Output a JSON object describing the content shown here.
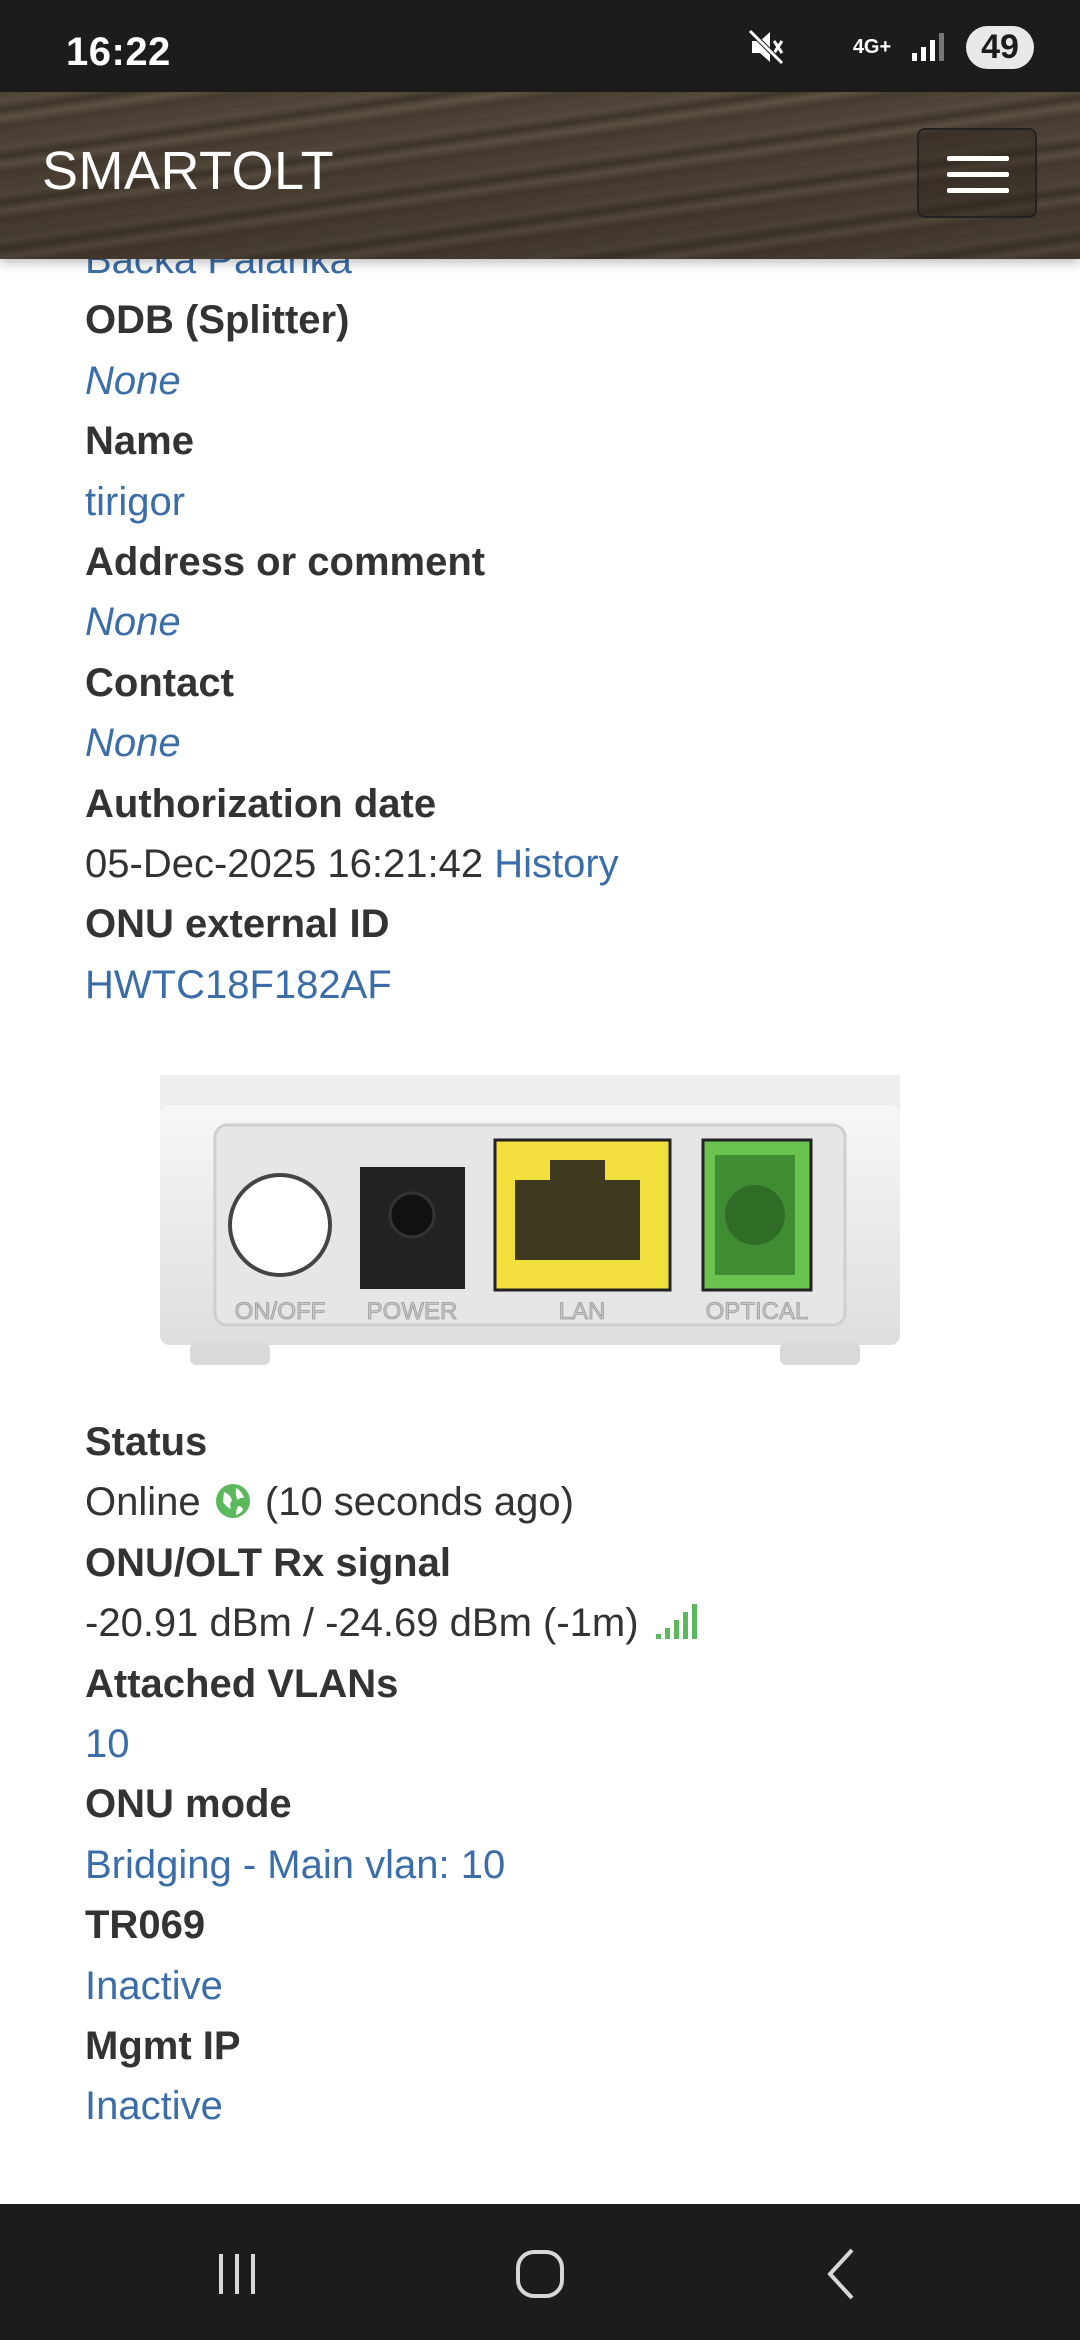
{
  "status_bar": {
    "time": "16:22",
    "network": "4G+",
    "battery": "49"
  },
  "navbar": {
    "brand": "SMARTOLT"
  },
  "details_top": {
    "partial_value": "Backa Palanka",
    "odb_label": "ODB (Splitter)",
    "odb_value": "None",
    "name_label": "Name",
    "name_value": "tirigor",
    "address_label": "Address or comment",
    "address_value": "None",
    "contact_label": "Contact",
    "contact_value": "None",
    "auth_label": "Authorization date",
    "auth_value": "05-Dec-2025 16:21:42",
    "history_link": "History",
    "ext_id_label": "ONU external ID",
    "ext_id_value": "HWTC18F182AF"
  },
  "device": {
    "ports": [
      "ON/OFF",
      "POWER",
      "LAN",
      "OPTICAL"
    ]
  },
  "details_bottom": {
    "status_label": "Status",
    "status_value": "Online",
    "status_time": "(10 seconds ago)",
    "signal_label": "ONU/OLT Rx signal",
    "signal_value": "-20.91 dBm / -24.69 dBm (-1m)",
    "vlans_label": "Attached VLANs",
    "vlans_value": "10",
    "mode_label": "ONU mode",
    "mode_value": "Bridging - Main vlan: 10",
    "tr069_label": "TR069",
    "tr069_value": "Inactive",
    "mgmt_label": "Mgmt IP",
    "mgmt_value": "Inactive"
  },
  "colors": {
    "link": "#3b6ea8",
    "label": "#333333",
    "online": "#5cb85c"
  }
}
